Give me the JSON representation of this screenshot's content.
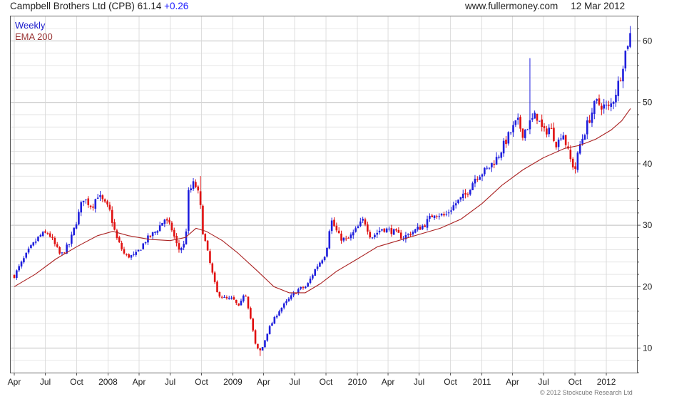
{
  "header": {
    "symbol_name": "Campbell Brothers Ltd (CPB)",
    "last": "61.14",
    "change": "+0.26",
    "source": "www.fullermoney.com",
    "date": "12 Mar 2012"
  },
  "footer": {
    "copyright": "© 2012 Stockcube Research Ltd"
  },
  "colors": {
    "up": "#1f1fdd",
    "down": "#e01010",
    "ema": "#aa2222",
    "grid": "#d6d6d6",
    "frame": "#555555"
  },
  "chart_data": {
    "type": "candlestick",
    "title": "Campbell Brothers Ltd (CPB) 61.14 +0.26",
    "frequency_label": "Weekly",
    "legend": [
      "Weekly",
      "EMA 200"
    ],
    "legend_placement": "top-left",
    "grid": true,
    "x_range": [
      "2007-04-01",
      "2012-03-12"
    ],
    "ylim": [
      6,
      64
    ],
    "y_axis_side": "right",
    "y_ticks": [
      10,
      20,
      30,
      40,
      50,
      60
    ],
    "x_ticks": [
      {
        "label": "Apr",
        "date": "2007-04-01"
      },
      {
        "label": "Jul",
        "date": "2007-07-01"
      },
      {
        "label": "Oct",
        "date": "2007-10-01"
      },
      {
        "label": "2008",
        "date": "2008-01-01"
      },
      {
        "label": "Apr",
        "date": "2008-04-01"
      },
      {
        "label": "Jul",
        "date": "2008-07-01"
      },
      {
        "label": "Oct",
        "date": "2008-10-01"
      },
      {
        "label": "2009",
        "date": "2009-01-01"
      },
      {
        "label": "Apr",
        "date": "2009-04-01"
      },
      {
        "label": "Jul",
        "date": "2009-07-01"
      },
      {
        "label": "Oct",
        "date": "2009-10-01"
      },
      {
        "label": "2010",
        "date": "2010-01-01"
      },
      {
        "label": "Apr",
        "date": "2010-04-01"
      },
      {
        "label": "Jul",
        "date": "2010-07-01"
      },
      {
        "label": "Oct",
        "date": "2010-10-01"
      },
      {
        "label": "2011",
        "date": "2011-01-01"
      },
      {
        "label": "Apr",
        "date": "2011-04-01"
      },
      {
        "label": "Jul",
        "date": "2011-07-01"
      },
      {
        "label": "Oct",
        "date": "2011-10-01"
      },
      {
        "label": "2012",
        "date": "2012-01-01"
      }
    ],
    "price_series": {
      "name": "Weekly",
      "close_path": [
        [
          "2007-04-01",
          21.8
        ],
        [
          "2007-05-15",
          26.0
        ],
        [
          "2007-06-15",
          28.3
        ],
        [
          "2007-07-10",
          28.8
        ],
        [
          "2007-08-15",
          25.0
        ],
        [
          "2007-09-10",
          27.0
        ],
        [
          "2007-10-05",
          31.5
        ],
        [
          "2007-10-20",
          34.5
        ],
        [
          "2007-11-15",
          33.0
        ],
        [
          "2007-12-01",
          35.0
        ],
        [
          "2008-01-05",
          32.5
        ],
        [
          "2008-01-25",
          28.0
        ],
        [
          "2008-02-20",
          25.0
        ],
        [
          "2008-03-20",
          25.0
        ],
        [
          "2008-04-20",
          27.5
        ],
        [
          "2008-05-20",
          29.0
        ],
        [
          "2008-06-15",
          31.0
        ],
        [
          "2008-07-05",
          29.5
        ],
        [
          "2008-07-25",
          26.0
        ],
        [
          "2008-08-15",
          27.0
        ],
        [
          "2008-08-22",
          35.0
        ],
        [
          "2008-09-10",
          37.0
        ],
        [
          "2008-09-25",
          34.5
        ],
        [
          "2008-10-05",
          29.0
        ],
        [
          "2008-10-25",
          24.0
        ],
        [
          "2008-11-15",
          19.0
        ],
        [
          "2008-12-10",
          18.0
        ],
        [
          "2009-01-01",
          18.0
        ],
        [
          "2009-01-20",
          16.5
        ],
        [
          "2009-02-05",
          19.5
        ],
        [
          "2009-02-25",
          14.0
        ],
        [
          "2009-03-10",
          10.0
        ],
        [
          "2009-03-25",
          9.5
        ],
        [
          "2009-04-15",
          13.0
        ],
        [
          "2009-05-15",
          16.0
        ],
        [
          "2009-06-15",
          18.0
        ],
        [
          "2009-07-10",
          19.5
        ],
        [
          "2009-08-05",
          20.0
        ],
        [
          "2009-09-01",
          23.0
        ],
        [
          "2009-10-01",
          25.5
        ],
        [
          "2009-10-15",
          31.0
        ],
        [
          "2009-11-10",
          28.0
        ],
        [
          "2009-12-01",
          27.5
        ],
        [
          "2009-12-25",
          29.0
        ],
        [
          "2010-01-20",
          31.0
        ],
        [
          "2010-02-10",
          28.0
        ],
        [
          "2010-03-15",
          29.5
        ],
        [
          "2010-04-15",
          29.0
        ],
        [
          "2010-05-15",
          28.0
        ],
        [
          "2010-06-15",
          29.0
        ],
        [
          "2010-07-15",
          30.0
        ],
        [
          "2010-08-15",
          32.0
        ],
        [
          "2010-09-15",
          31.5
        ],
        [
          "2010-10-15",
          33.5
        ],
        [
          "2010-11-15",
          35.0
        ],
        [
          "2010-12-15",
          38.0
        ],
        [
          "2011-01-15",
          39.0
        ],
        [
          "2011-02-15",
          41.0
        ],
        [
          "2011-03-15",
          44.0
        ],
        [
          "2011-04-15",
          47.0
        ],
        [
          "2011-05-01",
          45.0
        ],
        [
          "2011-05-20",
          46.5
        ],
        [
          "2011-06-10",
          48.0
        ],
        [
          "2011-07-01",
          45.0
        ],
        [
          "2011-07-20",
          46.0
        ],
        [
          "2011-08-10",
          43.0
        ],
        [
          "2011-08-25",
          45.5
        ],
        [
          "2011-09-15",
          41.0
        ],
        [
          "2011-10-01",
          39.0
        ],
        [
          "2011-10-15",
          43.0
        ],
        [
          "2011-11-10",
          47.0
        ],
        [
          "2011-12-01",
          50.0
        ],
        [
          "2011-12-20",
          49.5
        ],
        [
          "2012-01-10",
          49.0
        ],
        [
          "2012-01-25",
          51.0
        ],
        [
          "2012-02-10",
          54.0
        ],
        [
          "2012-02-25",
          58.0
        ],
        [
          "2012-03-05",
          60.0
        ],
        [
          "2012-03-12",
          61.14
        ]
      ],
      "wick_spikes": [
        {
          "date": "2011-05-20",
          "high": 57.2
        },
        {
          "date": "2008-09-25",
          "high": 38.0
        },
        {
          "date": "2009-03-25",
          "low": 8.7
        }
      ]
    },
    "ema_series": {
      "name": "EMA 200",
      "values": [
        [
          "2007-04-01",
          20.0
        ],
        [
          "2007-06-01",
          22.0
        ],
        [
          "2007-08-01",
          24.5
        ],
        [
          "2007-10-01",
          26.5
        ],
        [
          "2007-12-01",
          28.3
        ],
        [
          "2008-01-15",
          29.0
        ],
        [
          "2008-03-01",
          28.3
        ],
        [
          "2008-05-01",
          27.7
        ],
        [
          "2008-07-01",
          27.5
        ],
        [
          "2008-08-15",
          28.0
        ],
        [
          "2008-09-15",
          29.5
        ],
        [
          "2008-10-15",
          29.0
        ],
        [
          "2008-12-01",
          27.5
        ],
        [
          "2009-01-15",
          25.5
        ],
        [
          "2009-03-15",
          22.5
        ],
        [
          "2009-05-01",
          20.0
        ],
        [
          "2009-06-15",
          19.0
        ],
        [
          "2009-08-01",
          19.0
        ],
        [
          "2009-09-15",
          20.5
        ],
        [
          "2009-11-01",
          22.5
        ],
        [
          "2010-01-01",
          24.5
        ],
        [
          "2010-03-01",
          26.5
        ],
        [
          "2010-05-01",
          27.5
        ],
        [
          "2010-07-01",
          28.5
        ],
        [
          "2010-09-01",
          29.5
        ],
        [
          "2010-11-01",
          31.0
        ],
        [
          "2011-01-01",
          33.5
        ],
        [
          "2011-03-01",
          36.5
        ],
        [
          "2011-05-01",
          39.0
        ],
        [
          "2011-07-01",
          41.0
        ],
        [
          "2011-09-01",
          42.5
        ],
        [
          "2011-10-15",
          43.0
        ],
        [
          "2011-12-01",
          44.0
        ],
        [
          "2012-01-15",
          45.5
        ],
        [
          "2012-02-15",
          47.0
        ],
        [
          "2012-03-12",
          49.0
        ]
      ]
    }
  }
}
